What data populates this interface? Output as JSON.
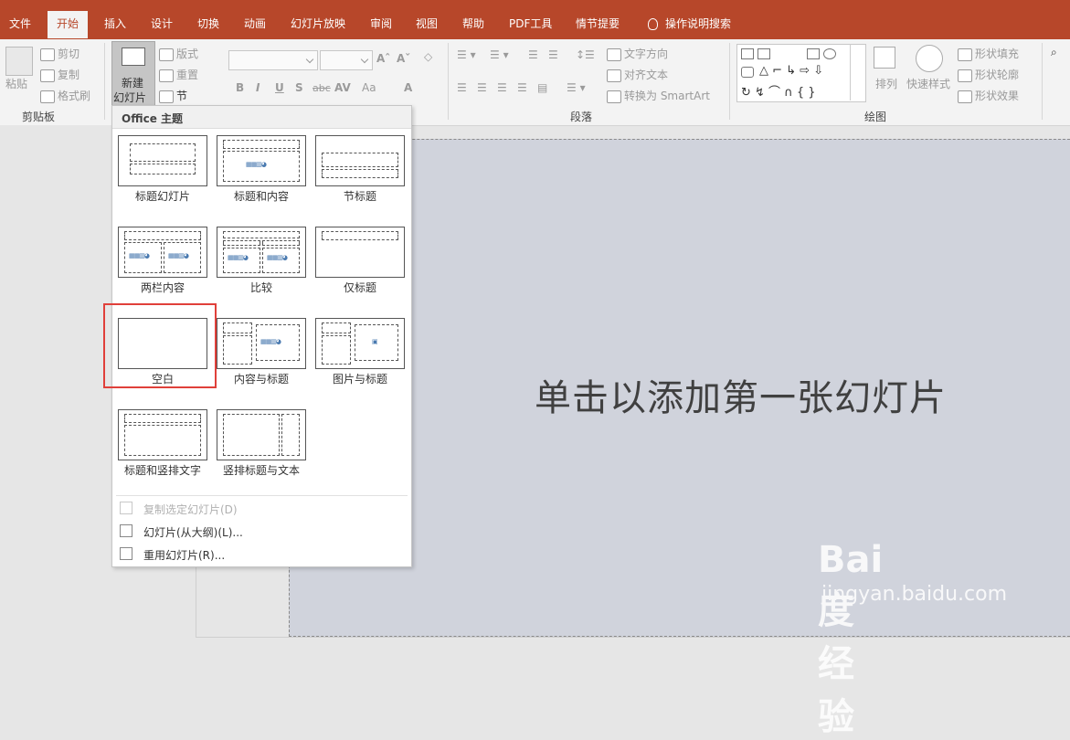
{
  "tabs": [
    {
      "label": "文件"
    },
    {
      "label": "开始"
    },
    {
      "label": "插入"
    },
    {
      "label": "设计"
    },
    {
      "label": "切换"
    },
    {
      "label": "动画"
    },
    {
      "label": "幻灯片放映"
    },
    {
      "label": "审阅"
    },
    {
      "label": "视图"
    },
    {
      "label": "帮助"
    },
    {
      "label": "PDF工具"
    },
    {
      "label": "情节提要"
    }
  ],
  "search_label": "操作说明搜索",
  "ribbon": {
    "clipboard": {
      "paste": "粘贴",
      "cut": "剪切",
      "copy": "复制",
      "format_painter": "格式刷",
      "group_label": "剪贴板"
    },
    "slides": {
      "new_slide_line1": "新建",
      "new_slide_line2": "幻灯片",
      "layout": "版式",
      "reset": "重置",
      "section": "节"
    },
    "font": {
      "bold": "B",
      "italic": "I",
      "underline": "U",
      "shadow": "S",
      "strike": "abc",
      "spacing": "AV",
      "case": "Aa",
      "color": "A"
    },
    "paragraph": {
      "text_direction": "文字方向",
      "align_text": "对齐文本",
      "convert_smartart": "转换为 SmartArt",
      "group_label": "段落"
    },
    "drawing": {
      "arrange": "排列",
      "quick_styles": "快速样式",
      "shape_fill": "形状填充",
      "shape_outline": "形状轮廓",
      "shape_effects": "形状效果",
      "group_label": "绘图"
    }
  },
  "dropdown": {
    "theme_header": "Office 主题",
    "layouts": [
      {
        "label": "标题幻灯片"
      },
      {
        "label": "标题和内容"
      },
      {
        "label": "节标题"
      },
      {
        "label": "两栏内容"
      },
      {
        "label": "比较"
      },
      {
        "label": "仅标题"
      },
      {
        "label": "空白"
      },
      {
        "label": "内容与标题"
      },
      {
        "label": "图片与标题"
      },
      {
        "label": "标题和竖排文字"
      },
      {
        "label": "竖排标题与文本"
      }
    ],
    "menu": [
      {
        "label": "复制选定幻灯片(D)",
        "enabled": false
      },
      {
        "label": "幻灯片(从大纲)(L)...",
        "enabled": true
      },
      {
        "label": "重用幻灯片(R)...",
        "enabled": true
      }
    ],
    "highlighted_layout": "空白"
  },
  "slide": {
    "placeholder_text": "单击以添加第一张幻灯片"
  },
  "watermark": {
    "logo_text": "Bai度经验",
    "url": "jingyan.baidu.com"
  },
  "colors": {
    "accent": "#b7472a",
    "highlight": "#e0403a",
    "slide_bg": "#d0d3dc"
  }
}
